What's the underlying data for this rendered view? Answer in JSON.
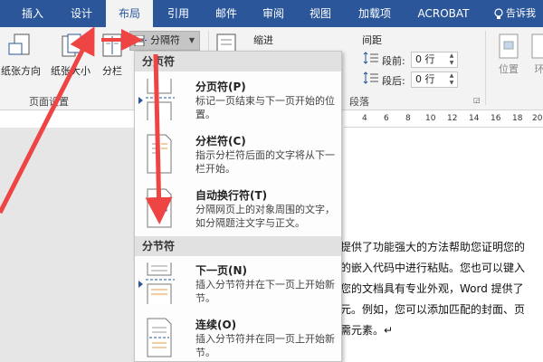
{
  "tabs": [
    {
      "label": "插入"
    },
    {
      "label": "设计"
    },
    {
      "label": "布局"
    },
    {
      "label": "引用"
    },
    {
      "label": "邮件"
    },
    {
      "label": "审阅"
    },
    {
      "label": "视图"
    },
    {
      "label": "加载项"
    },
    {
      "label": "ACROBAT"
    }
  ],
  "tell_me": "告诉我",
  "ribbon": {
    "orientation": "纸张方向",
    "size": "纸张大小",
    "columns": "分栏",
    "breaks": "分隔符",
    "group_page_setup": "页面设置",
    "indent": "缩进",
    "spacing": "间距",
    "before_label": "段前:",
    "before_value": "0 行",
    "after_label": "段后:",
    "after_value": "0 行",
    "group_paragraph": "段落",
    "position": "位置",
    "wrap": "环"
  },
  "ruler": [
    "4",
    "6",
    "8",
    "10",
    "12",
    "14",
    "16",
    "18",
    "20"
  ],
  "document": {
    "lines": [
      "提供了功能强大的方法帮助您证明您的",
      "的嵌入代码中进行粘贴。您也可以键入",
      "您的文档具有专业外观，Word 提供了",
      "元。例如，您可以添加匹配的封面、页",
      "需元素。↵"
    ]
  },
  "menu": {
    "section_page": "分页符",
    "section_section": "分节符",
    "items": [
      {
        "title": "分页符(P)",
        "desc": "标记一页结束与下一页开始的位置。"
      },
      {
        "title": "分栏符(C)",
        "desc": "指示分栏符后面的文字将从下一栏开始。"
      },
      {
        "title": "自动换行符(T)",
        "desc": "分隔网页上的对象周围的文字，如分隔题注文字与正文。"
      },
      {
        "title": "下一页(N)",
        "desc": "插入分节符并在下一页上开始新节。"
      },
      {
        "title": "连续(O)",
        "desc": "插入分节符并在同一页上开始新节。"
      }
    ]
  },
  "colors": {
    "accent": "#2b579a",
    "arrow": "#ee4444"
  }
}
